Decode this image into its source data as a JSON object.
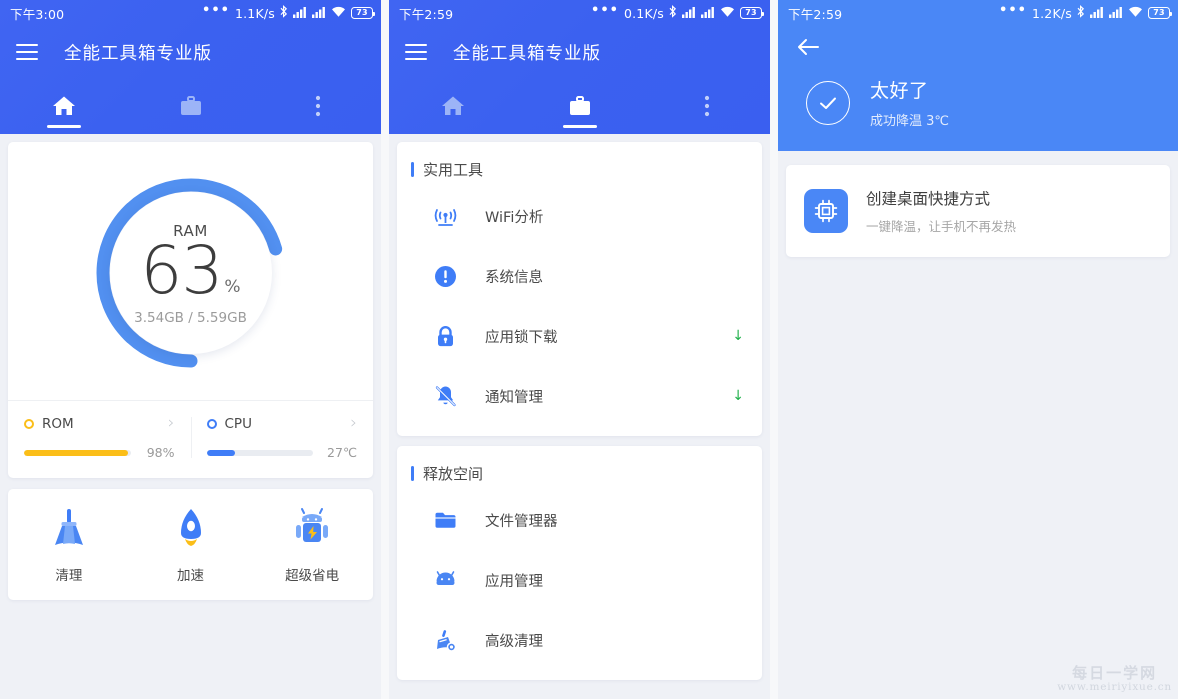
{
  "colors": {
    "header_blue": "#3b61f0",
    "header_light_blue": "#4a87f6",
    "accent_blue": "#4285f4",
    "rom_amber": "#fbbe18",
    "download_green": "#23b14d",
    "page_bg": "#eff1f6"
  },
  "panel1": {
    "status": {
      "time": "下午3:00",
      "dots": "•••",
      "speed": "1.1K/s",
      "battery_level": "73"
    },
    "appbar": {
      "title": "全能工具箱专业版",
      "menu_icon": "hamburger-icon"
    },
    "tabs": [
      {
        "id": "home",
        "icon": "home-icon",
        "active": true
      },
      {
        "id": "toolbox",
        "icon": "briefcase-icon",
        "active": false
      },
      {
        "id": "more",
        "icon": "more-vertical-icon",
        "active": false
      }
    ],
    "gauge": {
      "label": "RAM",
      "value": "63",
      "unit": "%",
      "detail": "3.54GB / 5.59GB",
      "percent": 63
    },
    "meters": [
      {
        "name": "ROM",
        "value": "98%",
        "percent": 98,
        "color": "#fbbe18",
        "chevron": "chevron-right-icon"
      },
      {
        "name": "CPU",
        "value": "27℃",
        "percent": 27,
        "color": "#3f7df7",
        "chevron": "chevron-right-icon"
      }
    ],
    "actions": [
      {
        "label": "清理",
        "icon": "broom-icon"
      },
      {
        "label": "加速",
        "icon": "rocket-icon"
      },
      {
        "label": "超级省电",
        "icon": "android-battery-icon"
      }
    ]
  },
  "panel2": {
    "status": {
      "time": "下午2:59",
      "dots": "•••",
      "speed": "0.1K/s",
      "battery_level": "73"
    },
    "appbar": {
      "title": "全能工具箱专业版",
      "menu_icon": "hamburger-icon"
    },
    "tabs": [
      {
        "id": "home",
        "icon": "home-icon",
        "active": false
      },
      {
        "id": "toolbox",
        "icon": "briefcase-icon",
        "active": true
      },
      {
        "id": "more",
        "icon": "more-vertical-icon",
        "active": false
      }
    ],
    "sections": [
      {
        "title": "实用工具",
        "items": [
          {
            "label": "WiFi分析",
            "icon": "wifi-analysis-icon",
            "download": ""
          },
          {
            "label": "系统信息",
            "icon": "info-circle-icon",
            "download": ""
          },
          {
            "label": "应用锁下载",
            "icon": "lock-icon",
            "download": "↓"
          },
          {
            "label": "通知管理",
            "icon": "bell-off-icon",
            "download": "↓"
          }
        ]
      },
      {
        "title": "释放空间",
        "items": [
          {
            "label": "文件管理器",
            "icon": "folder-icon",
            "download": ""
          },
          {
            "label": "应用管理",
            "icon": "android-icon",
            "download": ""
          },
          {
            "label": "高级清理",
            "icon": "advanced-clean-icon",
            "download": ""
          }
        ]
      }
    ]
  },
  "panel3": {
    "status": {
      "time": "下午2:59",
      "dots": "•••",
      "speed": "1.2K/s",
      "battery_level": "73"
    },
    "back_icon": "arrow-left-icon",
    "result": {
      "icon": "check-circle-icon",
      "title": "太好了",
      "subtitle": "成功降温 3℃"
    },
    "shortcut": {
      "icon": "cpu-chip-icon",
      "title": "创建桌面快捷方式",
      "subtitle": "一键降温，让手机不再发热"
    }
  },
  "watermark": {
    "line1": "每日一学网",
    "line2": "www.meiriyixue.cn"
  }
}
